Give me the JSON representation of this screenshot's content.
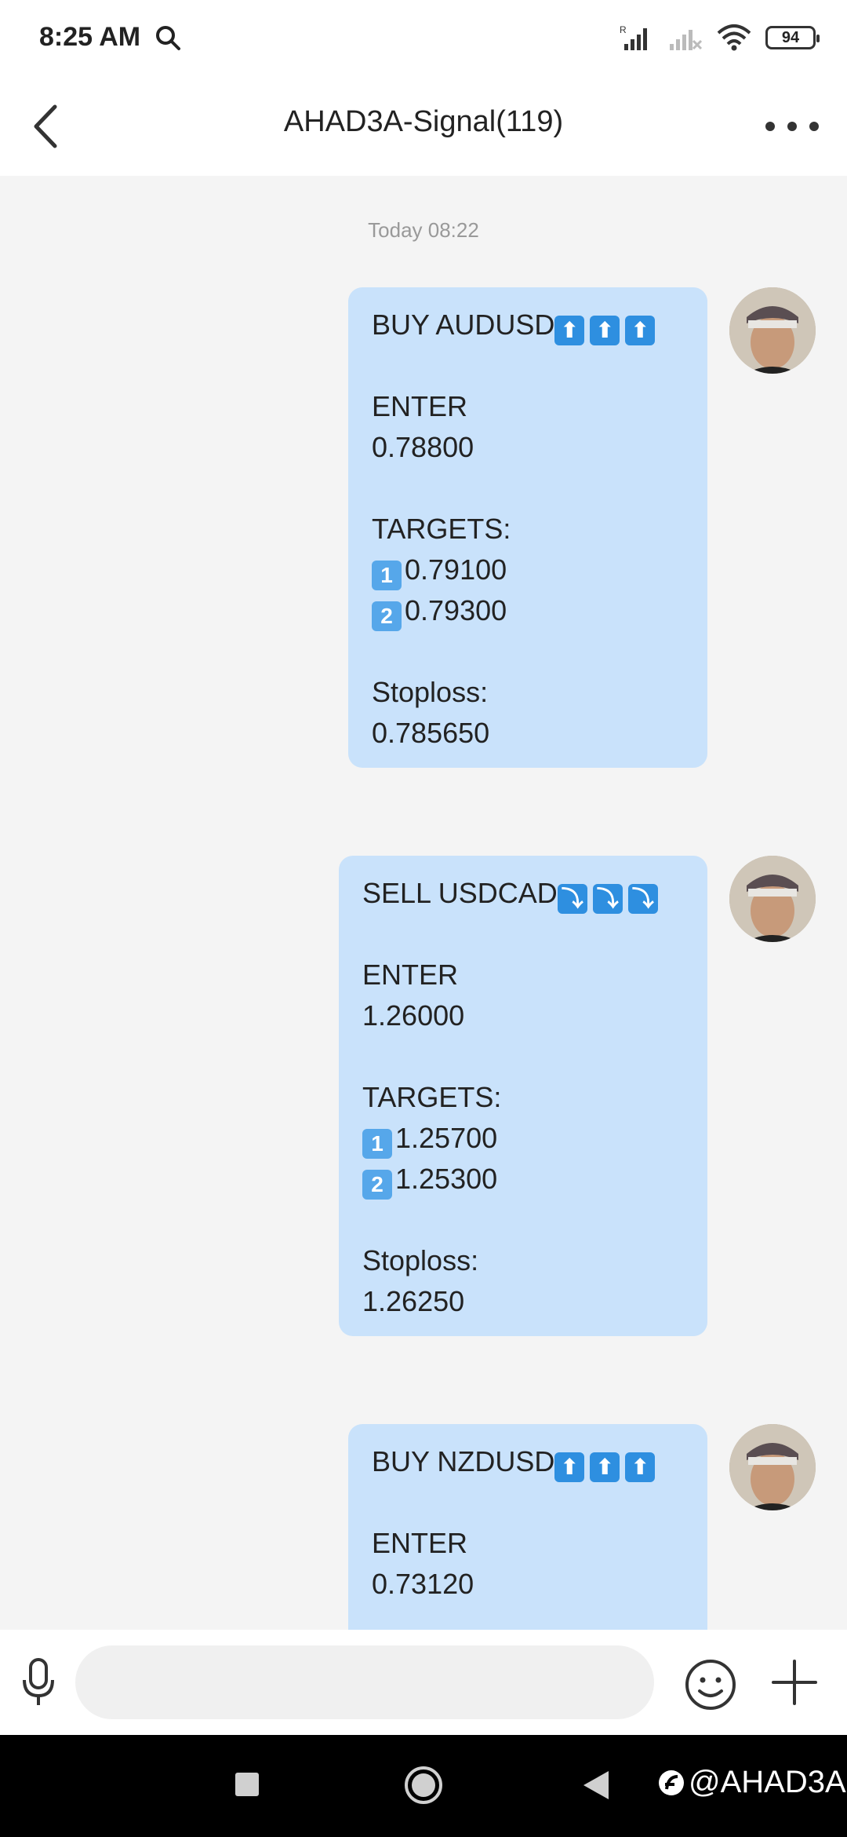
{
  "status_bar": {
    "time": "8:25 AM",
    "battery": "94",
    "icons": [
      "search-icon",
      "signal-icon",
      "signal-no-service-icon",
      "wifi-icon",
      "battery-icon"
    ]
  },
  "header": {
    "title": "AHAD3A-Signal(119)",
    "back_icon": "chevron-left-icon",
    "more_icon": "more-dots-icon"
  },
  "chat": {
    "timestamp": "Today 08:22",
    "messages": [
      {
        "pair": "BUY AUDUSD",
        "direction_emoji": "⬆",
        "enter_label": "ENTER",
        "enter_value": "0.78800",
        "targets_label": "TARGETS:",
        "target_1": "0.79100",
        "target_2": "0.79300",
        "stoploss_label": "Stoploss:",
        "stoploss_value": "0.785650"
      },
      {
        "pair": "SELL USDCAD",
        "direction_emoji": "⤵",
        "enter_label": "ENTER",
        "enter_value": "1.26000",
        "targets_label": "TARGETS:",
        "target_1": "1.25700",
        "target_2": "1.25300",
        "stoploss_label": "Stoploss:",
        "stoploss_value": "1.26250"
      },
      {
        "pair": "BUY NZDUSD",
        "direction_emoji": "⬆",
        "enter_label": "ENTER",
        "enter_value": "0.73120"
      }
    ],
    "keycap_1": "1",
    "keycap_2": "2"
  },
  "input_bar": {
    "placeholder": "",
    "icons": [
      "microphone-icon",
      "emoji-icon",
      "plus-icon"
    ]
  },
  "nav_bar": {
    "watermark": "@AHAD3A"
  },
  "colors": {
    "bubble": "#c9e2fb",
    "background": "#f4f4f4",
    "emoji_blue": "#2e8fe0"
  }
}
